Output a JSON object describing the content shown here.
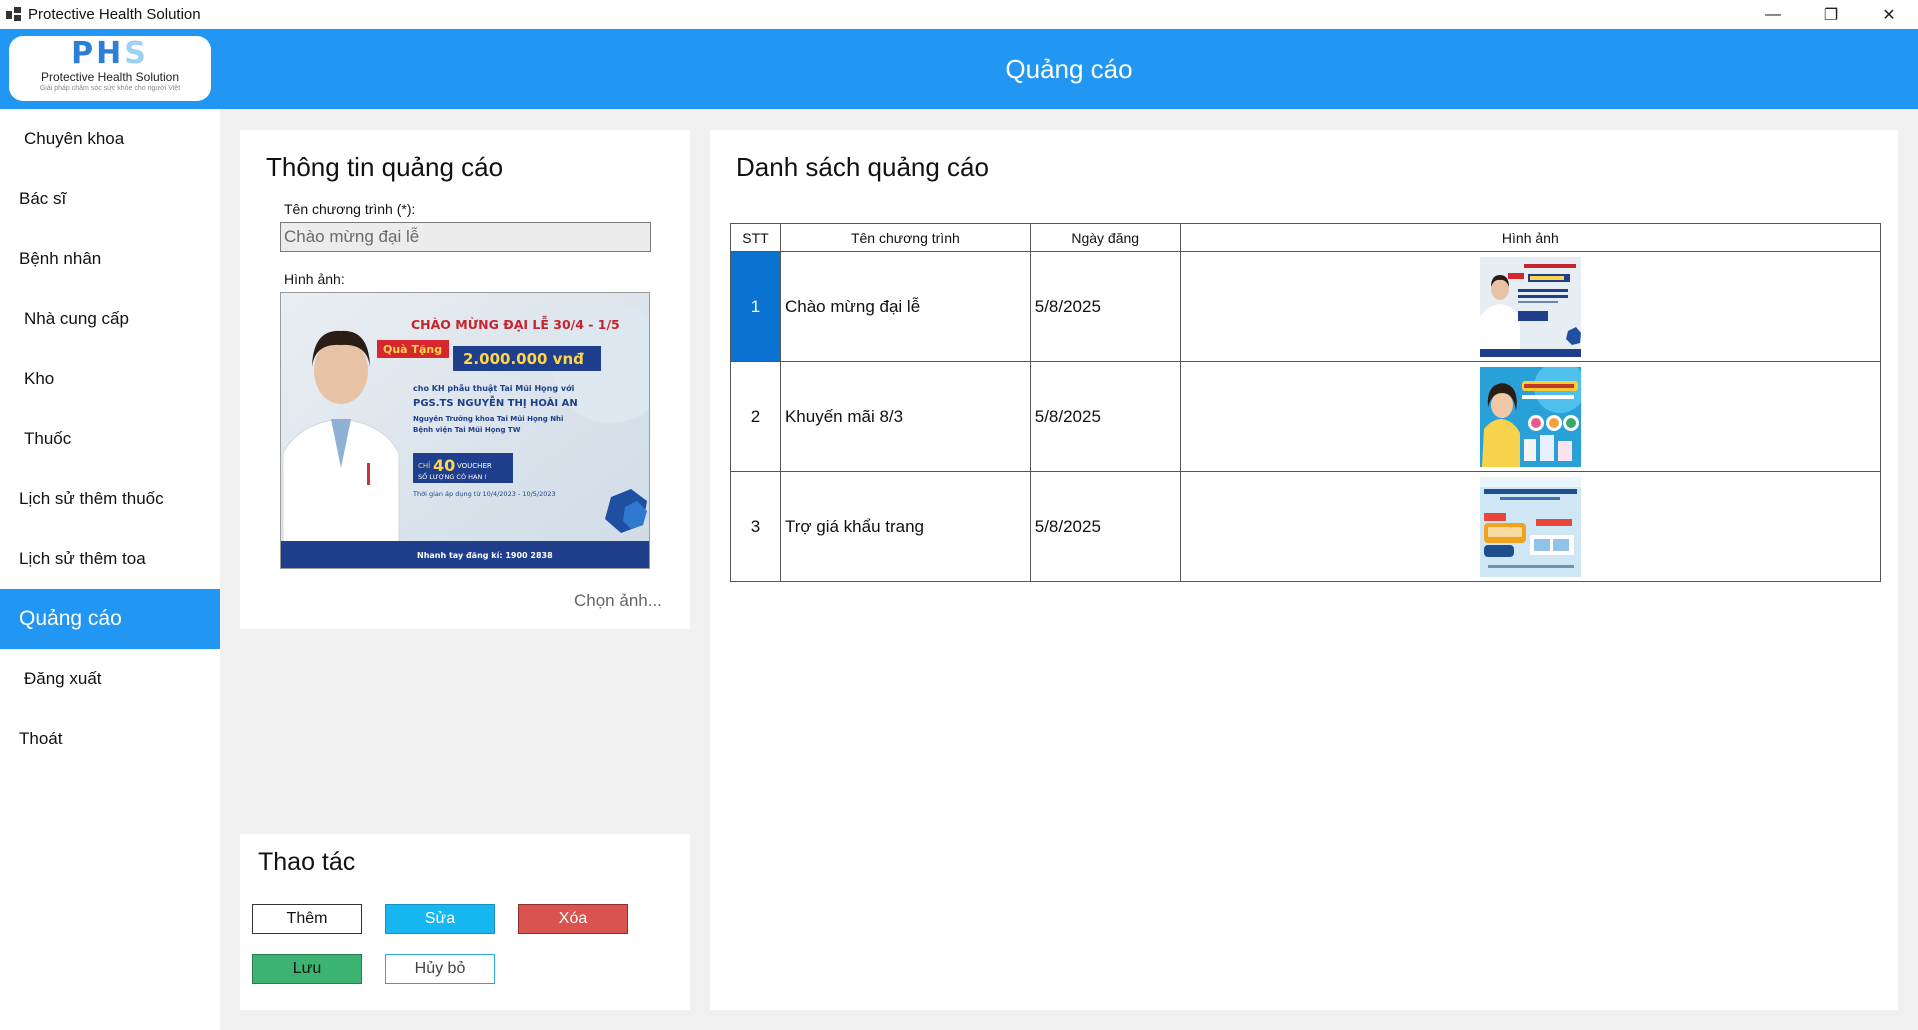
{
  "window": {
    "title": "Protective Health Solution",
    "min_glyph": "—",
    "max_glyph": "❐",
    "close_glyph": "✕"
  },
  "header": {
    "title": "Quảng cáo"
  },
  "logo": {
    "main_a": "PH",
    "main_b": "S",
    "sub": "Protective Health Solution",
    "tagline": "Giải pháp chăm sóc sức khỏe cho người Việt"
  },
  "sidebar": {
    "items": [
      {
        "label": "Chuyên khoa"
      },
      {
        "label": "Bác sĩ"
      },
      {
        "label": "Bệnh nhân"
      },
      {
        "label": "Nhà cung cấp"
      },
      {
        "label": "Kho"
      },
      {
        "label": "Thuốc"
      },
      {
        "label": "Lịch sử thêm thuốc"
      },
      {
        "label": "Lịch sử thêm toa"
      },
      {
        "label": "Quảng cáo"
      },
      {
        "label": "Đăng xuất"
      },
      {
        "label": "Thoát"
      }
    ],
    "active_index": 8
  },
  "info_panel": {
    "title": "Thông tin quảng cáo",
    "name_label": "Tên chương trình (*):",
    "name_value": "Chào mừng đại lễ",
    "image_label": "Hình ảnh:",
    "choose_image": "Chọn ảnh..."
  },
  "preview": {
    "headline": "CHÀO MỪNG ĐẠI LỄ 30/4 - 1/5",
    "gift_label": "Quà Tặng",
    "gift_amount": "2.000.000 vnđ",
    "line1": "cho KH phẫu thuật Tai Mũi Họng với",
    "doctor": "PGS.TS NGUYỄN THỊ HOÀI AN",
    "line2": "Nguyên Trưởng khoa Tai Mũi Họng Nhi",
    "line3": "Bệnh viện Tai Mũi Họng TW",
    "voucher_prefix": "CHỈ",
    "voucher_count": "40",
    "voucher_word": "VOUCHER",
    "voucher_limit": "SỐ LƯỢNG CÓ HẠN !",
    "period": "Thời gian áp dụng từ 10/4/2023 - 10/5/2023",
    "hotline": "Nhanh tay đăng kí: 1900 2838"
  },
  "actions": {
    "title": "Thao tác",
    "add": "Thêm",
    "edit": "Sửa",
    "delete": "Xóa",
    "save": "Lưu",
    "cancel": "Hủy bỏ"
  },
  "list_panel": {
    "title": "Danh sách quảng cáo",
    "columns": [
      "STT",
      "Tên chương trình",
      "Ngày đăng",
      "Hình ảnh"
    ],
    "rows": [
      {
        "stt": "1",
        "name": "Chào mừng đại lễ",
        "date": "5/8/2025",
        "image": "holiday-promo-thumbnail"
      },
      {
        "stt": "2",
        "name": "Khuyến mãi 8/3",
        "date": "5/8/2025",
        "image": "womens-day-promo-thumbnail"
      },
      {
        "stt": "3",
        "name": "Trợ giá khẩu trang",
        "date": "5/8/2025",
        "image": "mask-subsidy-thumbnail"
      }
    ]
  },
  "colors": {
    "accent": "#2196f3",
    "selected": "#0a72d0",
    "edit": "#16b6f0",
    "delete": "#d9534f",
    "save": "#3cb371"
  }
}
